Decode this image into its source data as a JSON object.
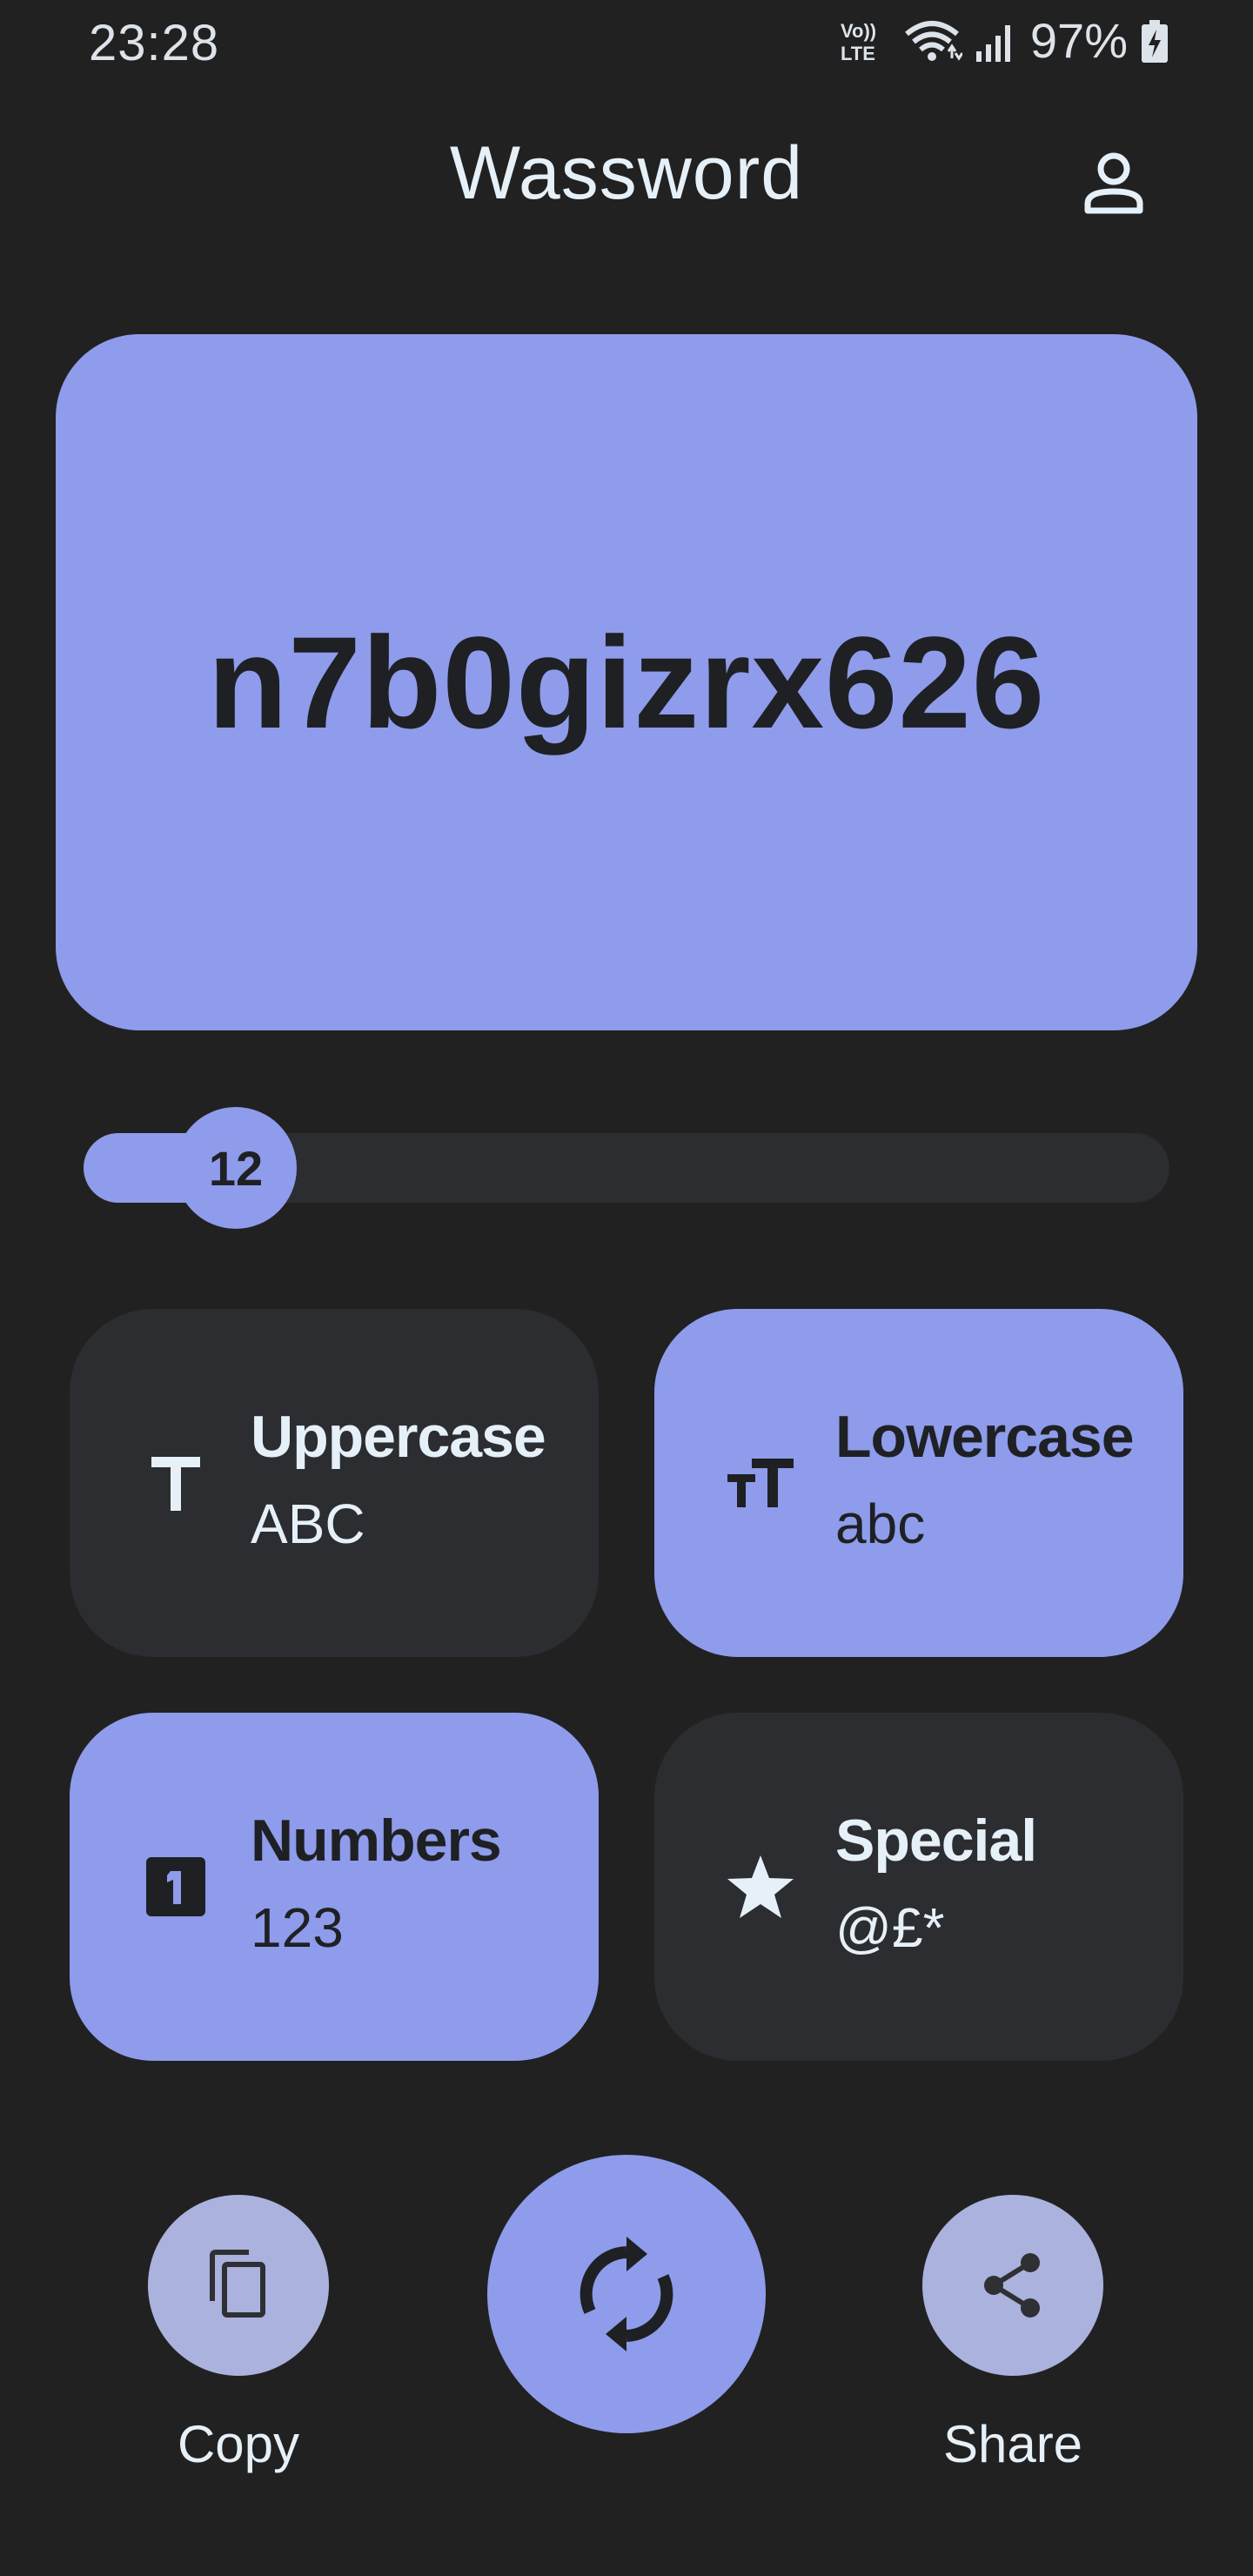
{
  "status_bar": {
    "time": "23:28",
    "volte_label": "Vo)) LTE",
    "battery_percent": "97%",
    "icons": [
      "volte-icon",
      "wifi-icon",
      "signal-icon",
      "battery-charging-icon"
    ]
  },
  "app_bar": {
    "title": "Wassword",
    "account_icon": "person-outline-icon"
  },
  "password": {
    "value": "n7b0gizrx626"
  },
  "length_slider": {
    "value": "12",
    "fraction": 0.14
  },
  "options": [
    {
      "id": "uppercase",
      "title": "Uppercase",
      "sample": "ABC",
      "enabled": false,
      "icon": "uppercase-t-icon"
    },
    {
      "id": "lowercase",
      "title": "Lowercase",
      "sample": "abc",
      "enabled": true,
      "icon": "text-size-icon"
    },
    {
      "id": "numbers",
      "title": "Numbers",
      "sample": "123",
      "enabled": true,
      "icon": "number-one-box-icon"
    },
    {
      "id": "special",
      "title": "Special",
      "sample": "@£*",
      "enabled": false,
      "icon": "star-icon"
    }
  ],
  "actions": {
    "copy_label": "Copy",
    "share_label": "Share",
    "copy_icon": "copy-icon",
    "regenerate_icon": "refresh-icon",
    "share_icon": "share-icon"
  },
  "colors": {
    "background": "#212121",
    "accent": "#8e9ceb",
    "tile_off": "#2c2d30",
    "secondary_button": "#aab2dd",
    "on_accent_text": "#1f2024",
    "text": "#e6f0f8"
  }
}
